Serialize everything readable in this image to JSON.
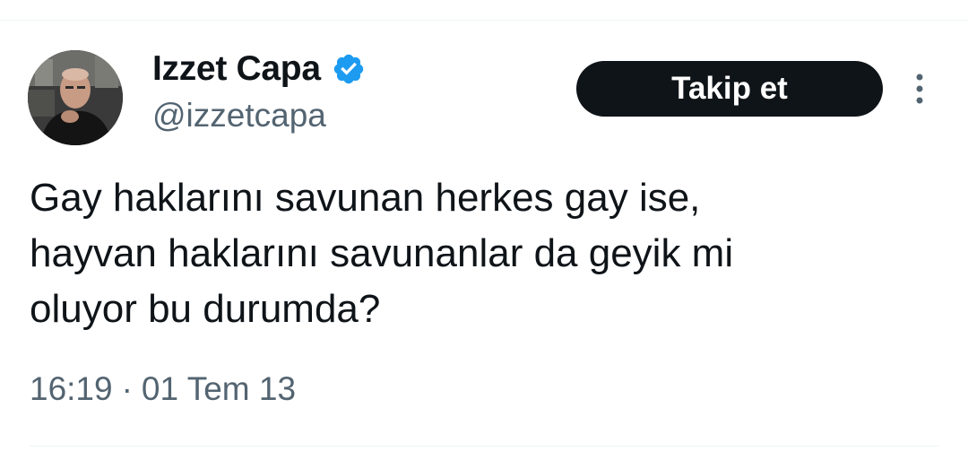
{
  "author": {
    "display_name": "Izzet Capa",
    "handle": "@izzetcapa",
    "verified": true,
    "avatar_icon": "profile-photo"
  },
  "follow_button": {
    "label": "Takip et"
  },
  "more_menu": {
    "icon": "more-vertical-icon"
  },
  "tweet": {
    "lines": [
      "Gay haklarını savunan herkes gay ise,",
      "hayvan haklarını savunanlar da geyik mi",
      "oluyor bu durumda?"
    ],
    "time": "16:19",
    "separator": "·",
    "date": "01 Tem 13"
  },
  "colors": {
    "verified_badge": "#1d9bf0",
    "button_bg": "#0f1419",
    "secondary_text": "#536471",
    "divider": "#eff3f4"
  }
}
